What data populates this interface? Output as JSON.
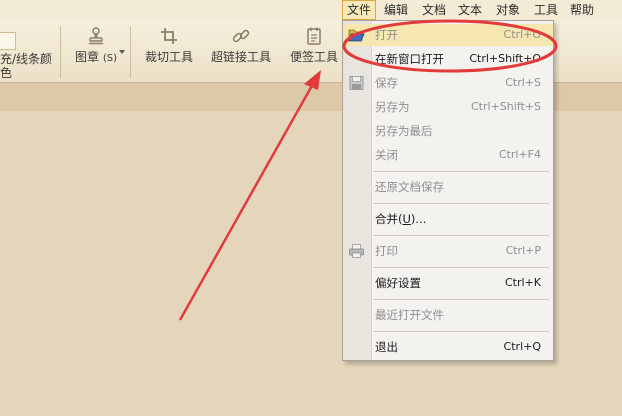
{
  "menubar": {
    "items": [
      {
        "label": "文件",
        "active": true
      },
      {
        "label": "编辑"
      },
      {
        "label": "文档"
      },
      {
        "label": "文本"
      },
      {
        "label": "对象"
      },
      {
        "label": "工具"
      },
      {
        "label": "帮助"
      }
    ]
  },
  "toolbar": {
    "fill_label": "充/线条颜色",
    "stamp_label": "图章",
    "stamp_shortcut": "(S)",
    "crop_label": "裁切工具",
    "link_label": "超链接工具",
    "note_label": "便签工具"
  },
  "file_menu": {
    "open": {
      "label": "打开",
      "shortcut": "Ctrl+O"
    },
    "open_new_window": {
      "label": "在新窗口打开",
      "shortcut": "Ctrl+Shift+O"
    },
    "save": {
      "label": "保存",
      "shortcut": "Ctrl+S"
    },
    "save_as": {
      "label": "另存为",
      "shortcut": "Ctrl+Shift+S"
    },
    "save_as_latest": {
      "label": "另存为最后"
    },
    "close": {
      "label": "关闭",
      "shortcut": "Ctrl+F4"
    },
    "restore": {
      "label": "还原文档保存"
    },
    "merge": {
      "label": "合并",
      "mnemonic": "U",
      "suffix": ")..."
    },
    "print": {
      "label": "打印",
      "shortcut": "Ctrl+P"
    },
    "preferences": {
      "label": "偏好设置",
      "shortcut": "Ctrl+K"
    },
    "recent": {
      "label": "最近打开文件"
    },
    "exit": {
      "label": "退出",
      "shortcut": "Ctrl+Q"
    }
  },
  "colors": {
    "annotation": "#e23b3b",
    "menu_highlight": "#f6e6b0",
    "background": "#e4d5bb"
  },
  "icons": [
    "folder-open-icon",
    "floppy-disk-icon",
    "printer-icon",
    "stamp-icon",
    "crop-icon",
    "link-icon",
    "note-icon"
  ]
}
